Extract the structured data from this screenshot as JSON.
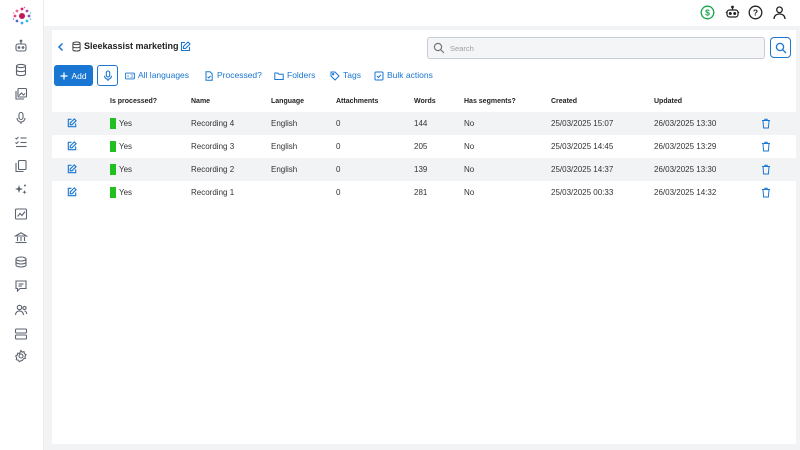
{
  "header": {
    "title": "Sleekassist marketing"
  },
  "search": {
    "placeholder": "Search"
  },
  "toolbar": {
    "add_label": "Add",
    "languages_label": "All languages",
    "processed_label": "Processed?",
    "folders_label": "Folders",
    "tags_label": "Tags",
    "bulk_label": "Bulk actions"
  },
  "table": {
    "columns": [
      "Is processed?",
      "Name",
      "Language",
      "Attachments",
      "Words",
      "Has segments?",
      "Created",
      "Updated"
    ],
    "rows": [
      {
        "processed": "Yes",
        "name": "Recording 4",
        "language": "English",
        "attachments": "0",
        "words": "144",
        "segments": "No",
        "created": "25/03/2025 15:07",
        "updated": "26/03/2025 13:30"
      },
      {
        "processed": "Yes",
        "name": "Recording 3",
        "language": "English",
        "attachments": "0",
        "words": "205",
        "segments": "No",
        "created": "25/03/2025 14:45",
        "updated": "26/03/2025 13:29"
      },
      {
        "processed": "Yes",
        "name": "Recording 2",
        "language": "English",
        "attachments": "0",
        "words": "139",
        "segments": "No",
        "created": "25/03/2025 14:37",
        "updated": "26/03/2025 13:30"
      },
      {
        "processed": "Yes",
        "name": "Recording 1",
        "language": "",
        "attachments": "0",
        "words": "281",
        "segments": "No",
        "created": "25/03/2025 00:33",
        "updated": "26/03/2025 14:32"
      }
    ]
  },
  "sidebar": {
    "icons": [
      "bot-icon",
      "database-icon",
      "gallery-icon",
      "microphone-icon",
      "checklist-icon",
      "documents-icon",
      "sparkles-icon",
      "chart-icon",
      "bank-icon",
      "stack-icon",
      "chat-icon",
      "users-icon",
      "server-icon",
      "settings-icon"
    ]
  },
  "topbar": {
    "icons": [
      "credit-dollar-icon",
      "robot-icon",
      "help-icon",
      "user-icon"
    ]
  },
  "colors": {
    "accent": "#1976d2",
    "processed_green": "#1fc01f",
    "credit_green": "#16a34a",
    "row_shade": "#f2f3f5"
  }
}
